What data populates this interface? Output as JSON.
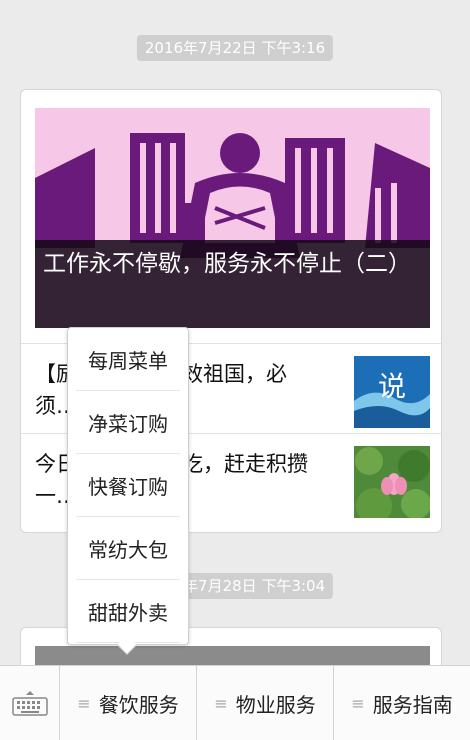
{
  "timestamps": {
    "first": "2016年7月22日 下午3:16",
    "second": "2016年7月28日 下午3:04"
  },
  "card1": {
    "cover_caption": "工作永不停歇，服务永不停止（二）",
    "articles": [
      {
        "title": "【励志】为了报效祖国，必须……",
        "thumb_text": "说"
      },
      {
        "title": "今日美食大家伴吃，赶走积攒一……"
      }
    ]
  },
  "popup_menu": {
    "items": [
      "每周菜单",
      "净菜订购",
      "快餐订购",
      "常纺大包",
      "甜甜外卖"
    ]
  },
  "bottom_menu": {
    "icon": "list-icon",
    "items": [
      "餐饮服务",
      "物业服务",
      "服务指南"
    ]
  },
  "colors": {
    "background": "#ebebeb",
    "cover_pink": "#f6c7e6",
    "cover_purple": "#6a1a7a",
    "timestamp_bg": "#cfcfcf"
  }
}
